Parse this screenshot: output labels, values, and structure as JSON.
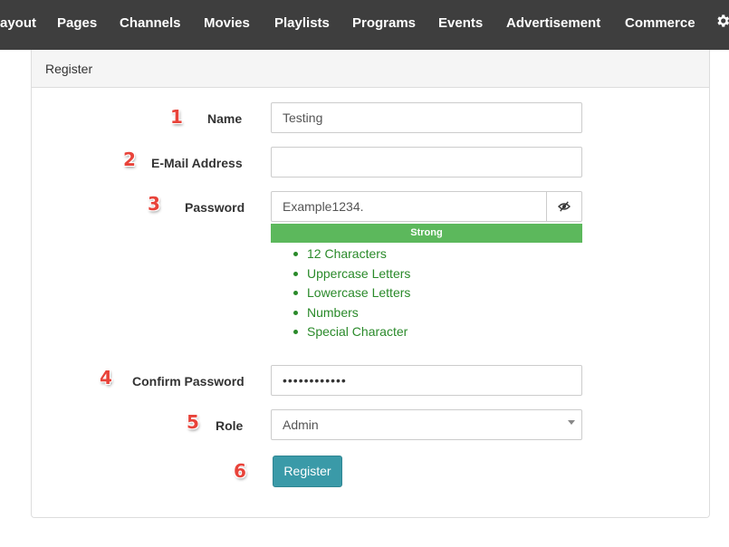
{
  "nav": {
    "items": [
      "ayout",
      "Pages",
      "Channels",
      "Movies",
      "Playlists",
      "Programs",
      "Events",
      "Advertisement",
      "Commerce"
    ],
    "settings_icon": "gear-icon"
  },
  "panel": {
    "title": "Register"
  },
  "form": {
    "name": {
      "number": "1",
      "label": "Name",
      "value": "Testing"
    },
    "email": {
      "number": "2",
      "label": "E-Mail Address",
      "value": ""
    },
    "password": {
      "number": "3",
      "label": "Password",
      "value": "Example1234.",
      "toggle_icon": "eye-slash-icon",
      "strength": "Strong",
      "strength_color": "#5cb85c",
      "requirements": [
        "12 Characters",
        "Uppercase Letters",
        "Lowercase Letters",
        "Numbers",
        "Special Character"
      ],
      "requirement_color": "#2a8a2a"
    },
    "confirm": {
      "number": "4",
      "label": "Confirm Password",
      "value": "••••••••••••"
    },
    "role": {
      "number": "5",
      "label": "Role",
      "value": "Admin"
    },
    "submit": {
      "number": "6",
      "label": "Register",
      "color": "#3a9aa8"
    }
  }
}
